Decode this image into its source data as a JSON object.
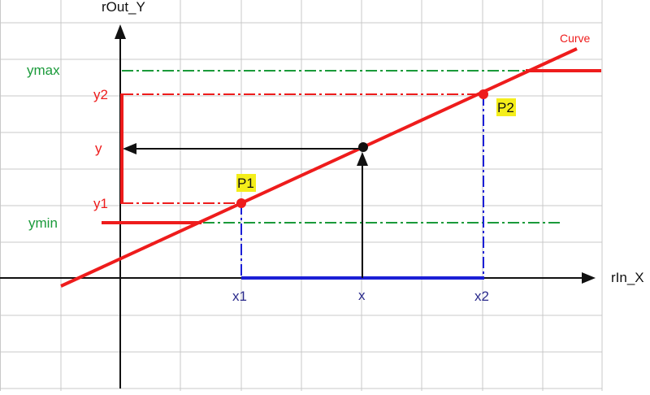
{
  "axes": {
    "x_label": "rIn_X",
    "y_label": "rOut_Y"
  },
  "curve": {
    "label": "Curve",
    "color": "#ee1c1c"
  },
  "x_markers": {
    "x1": "x1",
    "x": "x",
    "x2": "x2"
  },
  "y_markers": {
    "ymax": "ymax",
    "y2": "y2",
    "y": "y",
    "y1": "y1",
    "ymin": "ymin"
  },
  "points": {
    "p1": "P1",
    "p2": "P2"
  },
  "colors": {
    "grid": "#c8c8c8",
    "red": "#ee1c1c",
    "green": "#1a9a3a",
    "blue": "#1b1fd6",
    "blue_label": "#2a2a8c",
    "black": "#111111",
    "highlight": "#f4ee1a"
  }
}
